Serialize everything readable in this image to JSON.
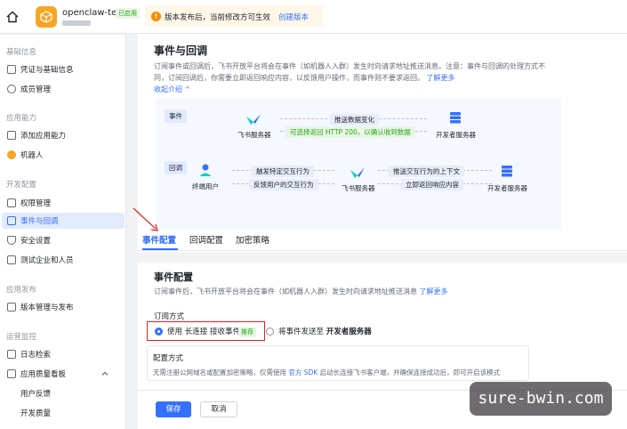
{
  "topbar": {
    "app_name": "openclaw-test",
    "app_badge": "已启用",
    "notice_text": "版本发布后，当前修改方可生效",
    "notice_link": "创建版本"
  },
  "sidebar": {
    "sections": [
      {
        "title": "基础信息",
        "items": [
          "凭证与基础信息",
          "成员管理"
        ]
      },
      {
        "title": "应用能力",
        "items": [
          "添加应用能力",
          "机器人"
        ]
      },
      {
        "title": "开发配置",
        "items": [
          "权限管理",
          "事件与回调",
          "安全设置",
          "测试企业和人员"
        ]
      },
      {
        "title": "应用发布",
        "items": [
          "版本管理与发布"
        ]
      },
      {
        "title": "运营监控",
        "items": [
          "日志检索",
          "应用质量看板"
        ]
      }
    ],
    "subitems": [
      "用户反馈",
      "开发质量"
    ],
    "active": "事件与回调"
  },
  "main": {
    "title": "事件与回调",
    "desc_line1": "订阅事件或回调后，飞书开放平台将会在事件（如机器人入群）发生时向请求地址推送消息。注意：事件与回调的处理方式不",
    "desc_line2": "同，订阅回调后，你需要立即返回响应内容，以反馈用户操作，而事件则不要求返回。",
    "desc_link": "了解更多",
    "collapse": "收起介绍",
    "diagram": {
      "event_tag": "事件",
      "callback_tag": "回调",
      "feishu_server": "飞书服务器",
      "dev_server": "开发者服务器",
      "end_user": "终端用户",
      "push_data": "推送数据变化",
      "return_200": "可选择返回 HTTP 200，以确认收到数据",
      "trigger": "触发特定交互行为",
      "feedback": "反馈用户的交互行为",
      "push_context": "推送交互行为的上下文",
      "return_response": "立即返回响应内容"
    },
    "tabs": [
      "事件配置",
      "回调配置",
      "加密策略"
    ],
    "section_title": "事件配置",
    "section_desc": "订阅事件后，飞书开放平台将会在事件（如机器人入群）发生时向请求地址推送消息",
    "section_link": "了解更多",
    "sub_label": "订阅方式",
    "opt1_a": "使用",
    "opt1_b": "长连接",
    "opt1_c": "接收事件",
    "opt1_badge": "推荐",
    "opt2_a": "将事件发送至",
    "opt2_b": "开发者服务器",
    "cfg_title": "配置方式",
    "cfg_text_a": "无需注册公网域名或配置加密策略，仅需使用",
    "cfg_text_link": "官方 SDK",
    "cfg_text_b": "启动长连接飞书客户端，并确保连接成功后，即可开启该模式",
    "save": "保存",
    "cancel": "取消"
  },
  "watermark": "sure-bwin.com",
  "colors": {
    "accent": "#3370ff",
    "success": "#2ea121",
    "highlight": "#e02020"
  }
}
